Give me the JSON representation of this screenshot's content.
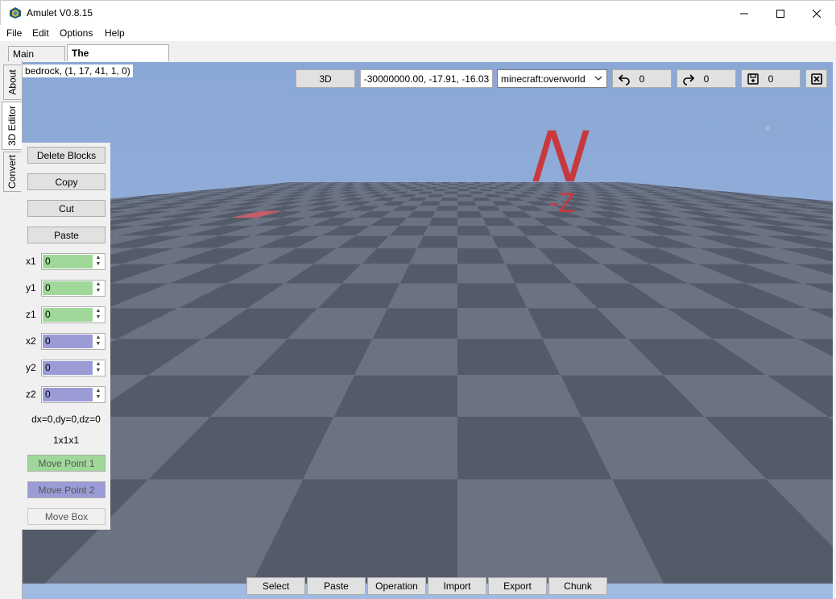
{
  "window": {
    "title": "Amulet V0.8.15"
  },
  "menu": {
    "items": [
      "File",
      "Edit",
      "Options",
      "Help"
    ]
  },
  "tabs": [
    {
      "label": "Main Menu"
    },
    {
      "label": "The Experimentals",
      "close": "×"
    }
  ],
  "side_tabs": [
    "About",
    "3D Editor",
    "Convert"
  ],
  "viewport": {
    "block_info": "bedrock, (1, 17, 41, 1, 0)",
    "compass_letter": "N",
    "compass_axis": "-Z"
  },
  "toolbar": {
    "view_mode": "3D",
    "coordinates": "-30000000.00, -17.91, -16.03",
    "dimension": "minecraft:overworld",
    "undo_count": "0",
    "redo_count": "0",
    "save_count": "0"
  },
  "selection_panel": {
    "buttons": {
      "delete": "Delete Blocks",
      "copy": "Copy",
      "cut": "Cut",
      "paste": "Paste"
    },
    "fields": [
      {
        "label": "x1",
        "value": "0"
      },
      {
        "label": "y1",
        "value": "0"
      },
      {
        "label": "z1",
        "value": "0"
      },
      {
        "label": "x2",
        "value": "0"
      },
      {
        "label": "y2",
        "value": "0"
      },
      {
        "label": "z2",
        "value": "0"
      }
    ],
    "delta": "dx=0,dy=0,dz=0",
    "size": "1x1x1",
    "move_point_1": "Move Point 1",
    "move_point_2": "Move Point 2",
    "move_box": "Move Box"
  },
  "bottom_toolbar": [
    "Select",
    "Paste",
    "Operation",
    "Import",
    "Export",
    "Chunk"
  ],
  "colors": {
    "point1": "#a0d89a",
    "point2": "#9b9bd6",
    "sky": "#97b2da",
    "tile_dark": "#545b68",
    "tile_light": "#6b7281",
    "highlight": "#c45c6a",
    "compass": "#c9383d"
  }
}
